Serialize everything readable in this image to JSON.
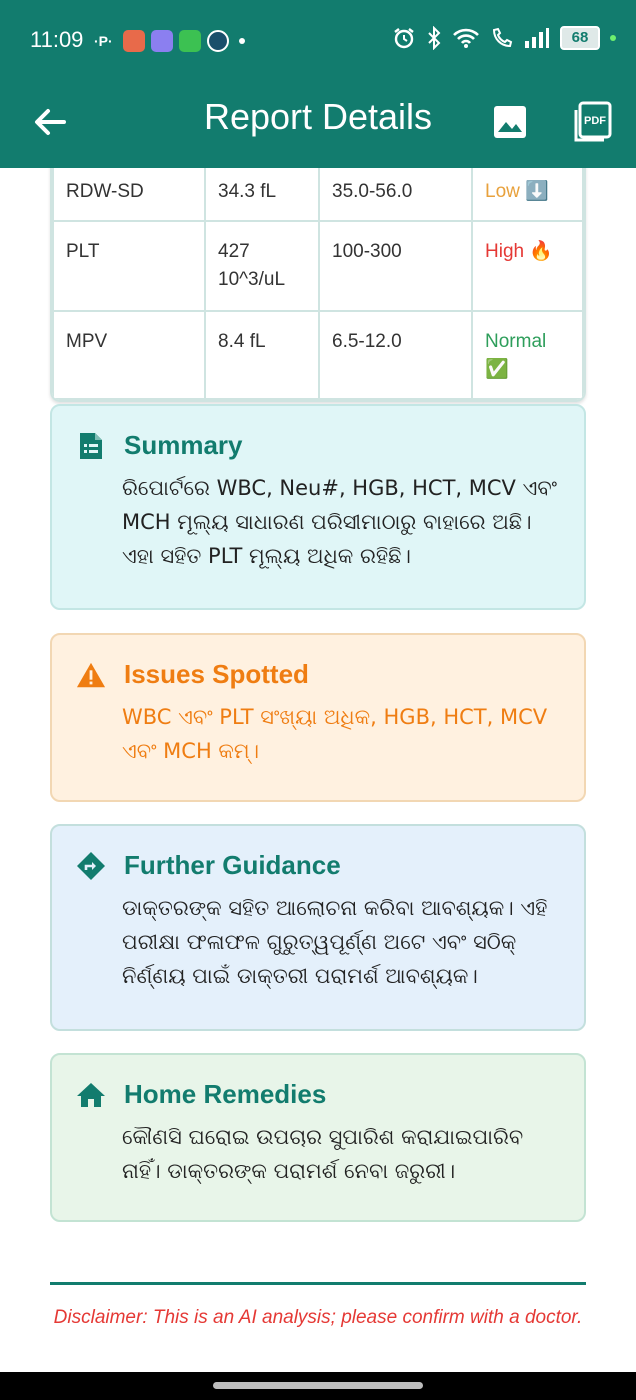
{
  "status_bar": {
    "time": "11:09",
    "p_label": "·P·",
    "battery": "68",
    "colors": {
      "bg": "#127c6e"
    }
  },
  "app_bar": {
    "title": "Report Details",
    "icons": [
      "back-arrow-icon",
      "image-icon",
      "pdf-icon"
    ]
  },
  "table": {
    "rows": [
      {
        "name": "RDW-SD",
        "value": "34.3 fL",
        "range": "35.0-56.0",
        "status": "Low ⬇️"
      },
      {
        "name": "PLT",
        "value": "427 10^3/uL",
        "range": "100-300",
        "status": "High 🔥"
      },
      {
        "name": "MPV",
        "value": "8.4 fL",
        "range": "6.5-12.0",
        "status": "Normal ✅"
      }
    ]
  },
  "summary": {
    "title": "Summary",
    "body": "ରିପୋର୍ଟରେ WBC, Neu#, HGB, HCT, MCV ଏବଂ MCH ମୂଲ୍ୟ ସାଧାରଣ ପରିସୀମାଠାରୁ ବାହାରେ ଅଛି। ଏହା ସହିତ PLT ମୂଲ୍ୟ ଅଧିକ ରହିଛି।"
  },
  "issues": {
    "title": "Issues Spotted",
    "body": "WBC ଏବଂ PLT ସଂଖ୍ୟା ଅଧିକ, HGB, HCT, MCV ଏବଂ MCH କମ୍।"
  },
  "guidance": {
    "title": "Further Guidance",
    "body": "ଡାକ୍ତରଙ୍କ ସହିତ ଆଲୋଚନା କରିବା ଆବଶ୍ୟକ। ଏହି ପରୀକ୍ଷା ଫଳାଫଳ ଗୁରୁତ୍ୱପୂର୍ଣ୍ଣ ଅଟେ ଏବଂ ସଠିକ୍ ନିର୍ଣ୍ଣୟ ପାଇଁ ଡାକ୍ତରୀ ପରାମର୍ଶ ଆବଶ୍ୟକ।"
  },
  "remedies": {
    "title": "Home Remedies",
    "body": "କୌଣସି ଘରୋଇ ଉପଚାର ସୁପାରିଶ କରାଯାଇପାରିବ ନାହିଁ। ଡାକ୍ତରଙ୍କ ପରାମର୍ଶ ନେବା ଜରୁରୀ।"
  },
  "disclaimer": "Disclaimer: This is an AI analysis; please confirm with a doctor."
}
